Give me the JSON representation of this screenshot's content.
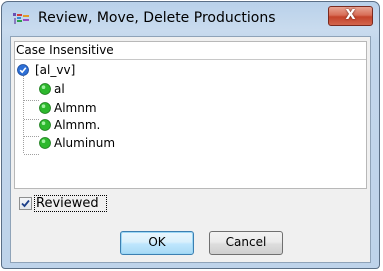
{
  "window": {
    "title": "Review, Move, Delete Productions"
  },
  "tree": {
    "header": "Case Insensitive",
    "root": {
      "label": "[al_vv]",
      "icon": "blue-check-icon"
    },
    "children": [
      {
        "label": "al",
        "icon": "green-circle-icon"
      },
      {
        "label": "Almnm",
        "icon": "green-circle-icon"
      },
      {
        "label": "Almnm.",
        "icon": "green-circle-icon"
      },
      {
        "label": "Aluminum",
        "icon": "green-circle-icon"
      }
    ]
  },
  "reviewed": {
    "label": "Reviewed",
    "checked": true
  },
  "buttons": {
    "ok_label": "OK",
    "cancel_label": "Cancel",
    "close_label": "X"
  },
  "colors": {
    "accent": "#3c7fb1",
    "close": "#c4432a",
    "node_green": "#2db82d",
    "root_blue": "#2d6fd6"
  }
}
